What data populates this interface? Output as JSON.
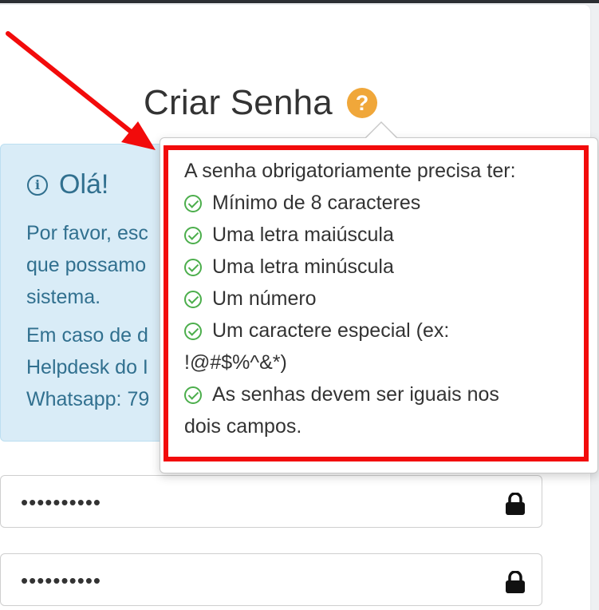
{
  "page": {
    "title": "Criar Senha",
    "help_icon": "?"
  },
  "alert": {
    "icon": "info-circle-icon",
    "title": "Olá!",
    "lines": [
      "Por favor, esc",
      "que possamo",
      "sistema.",
      "Em caso de d",
      "Helpdesk do I",
      "Whatsapp: 79"
    ]
  },
  "popover": {
    "heading": "A senha obrigatoriamente precisa ter:",
    "requirements": [
      "Mínimo de 8 caracteres",
      "Uma letra maiúscula",
      "Uma letra minúscula",
      "Um número",
      "Um caractere especial (ex:",
      "As senhas devem ser iguais nos"
    ],
    "continuations": [
      "!@#$%^&*)",
      "dois campos."
    ]
  },
  "fields": {
    "password_value": "••••••••••",
    "confirm_value": "••••••••••"
  },
  "colors": {
    "accent": "#f0a73a",
    "info": "#31708f",
    "success": "#4cae4c",
    "highlight": "#f20b0b"
  }
}
